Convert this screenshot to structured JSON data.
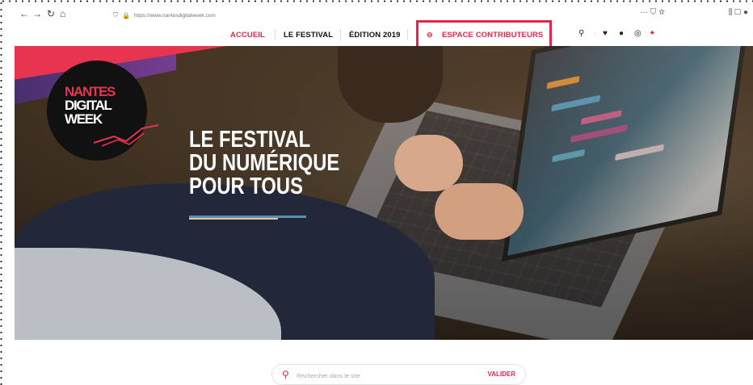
{
  "browser": {
    "url": "https://www.nantesdigitalweek.com",
    "back_icon": "arrow-left-icon",
    "forward_icon": "arrow-right-icon",
    "reload_icon": "reload-icon",
    "home_icon": "home-icon"
  },
  "nav": {
    "items": [
      {
        "label": "ACCUEIL",
        "color": "#e4264a"
      },
      {
        "label": "LE FESTIVAL",
        "color": "#111111"
      },
      {
        "label": "ÉDITION 2019",
        "color": "#111111"
      },
      {
        "label": "ESPACE CONTRIBUTEURS",
        "color": "#e4264a"
      }
    ],
    "lock_icon": "lock-icon",
    "highlight_color": "#e4264a"
  },
  "social": {
    "items": [
      "search-icon",
      "twitter-icon",
      "facebook-icon",
      "instagram-icon",
      "logo-bird-icon"
    ]
  },
  "hero": {
    "logo": [
      "NANTES",
      "DIGITAL",
      "WEEK"
    ],
    "headline": [
      "LE FESTIVAL",
      "DU NUMÉRIQUE",
      "POUR TOUS"
    ]
  },
  "search": {
    "placeholder": "Rechercher dans le site",
    "button_label": "VALIDER"
  }
}
